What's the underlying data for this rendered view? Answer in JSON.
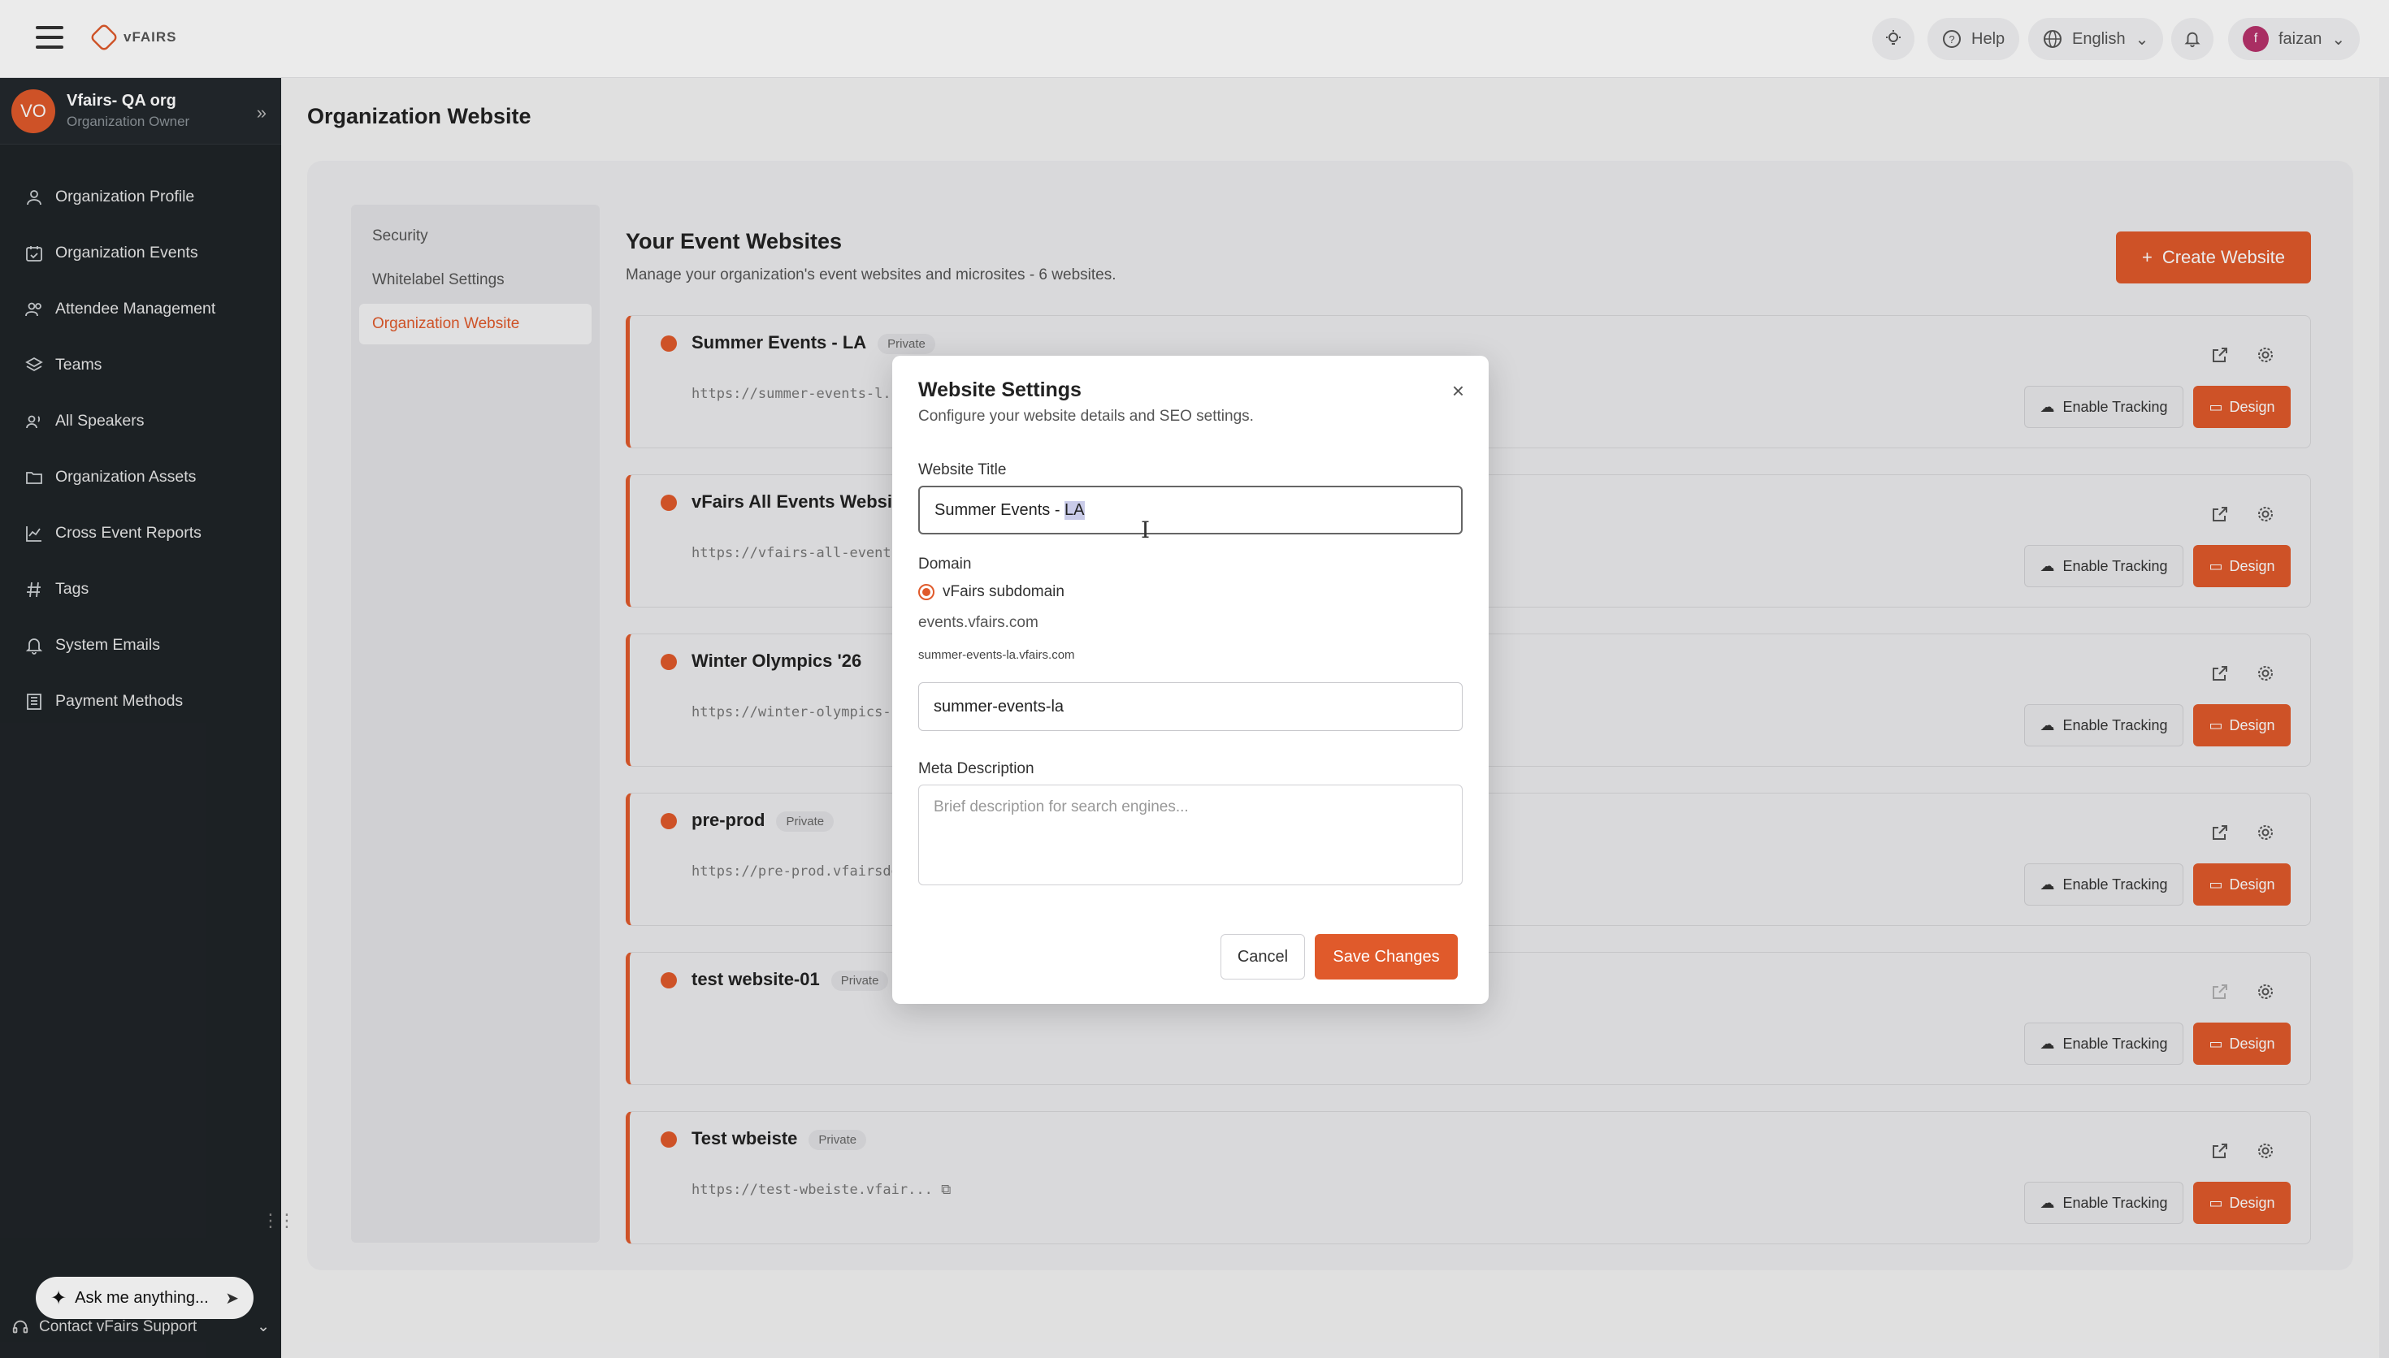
{
  "topbar": {
    "logo_text": "vFAIRS",
    "help_label": "Help",
    "language": "English",
    "user_initial": "f",
    "user_name": "faizan"
  },
  "sidebar": {
    "org_initials": "VO",
    "org_name": "Vfairs- QA org",
    "org_role": "Organization Owner",
    "items": [
      {
        "label": "Organization Profile",
        "icon": "user-icon"
      },
      {
        "label": "Organization Events",
        "icon": "calendar-check-icon"
      },
      {
        "label": "Attendee Management",
        "icon": "users-icon"
      },
      {
        "label": "Teams",
        "icon": "layers-icon"
      },
      {
        "label": "All Speakers",
        "icon": "speakers-icon"
      },
      {
        "label": "Organization Assets",
        "icon": "folder-icon"
      },
      {
        "label": "Cross Event Reports",
        "icon": "line-chart-icon"
      },
      {
        "label": "Tags",
        "icon": "hash-icon"
      },
      {
        "label": "System Emails",
        "icon": "bell-icon"
      },
      {
        "label": "Payment Methods",
        "icon": "building-icon"
      }
    ],
    "ask_placeholder": "Ask me anything...",
    "support_label": "Contact vFairs Support"
  },
  "page": {
    "title": "Organization Website"
  },
  "subnav": {
    "items": [
      "Security",
      "Whitelabel Settings",
      "Organization Website"
    ],
    "active": "Organization Website"
  },
  "websites": {
    "title": "Your Event Websites",
    "subtitle": "Manage your organization's event websites and microsites - 6 websites.",
    "create_label": "Create Website",
    "track_label": "Enable Tracking",
    "design_label": "Design",
    "items": [
      {
        "name": "Summer Events - LA",
        "badge": "Private",
        "url": "https://summer-events-l..."
      },
      {
        "name": "vFairs All Events Website",
        "badge": "",
        "url": "https://vfairs-all-events-..."
      },
      {
        "name": "Winter Olympics '26",
        "badge": "",
        "url": "https://winter-olympics-..."
      },
      {
        "name": "pre-prod",
        "badge": "Private",
        "url": "https://pre-prod.vfairsde..."
      },
      {
        "name": "test website-01",
        "badge": "Private",
        "url": ""
      },
      {
        "name": "Test wbeiste",
        "badge": "Private",
        "url": "https://test-wbeiste.vfair..."
      }
    ]
  },
  "modal": {
    "title": "Website Settings",
    "subtitle": "Configure your website details and SEO settings.",
    "website_title_label": "Website Title",
    "website_title_value_plain": "Summer Events - ",
    "website_title_value_selected": "LA",
    "domain_label": "Domain",
    "domain_option": "vFairs subdomain",
    "domain_base": "events.vfairs.com",
    "domain_preview": "summer-events-la.vfairs.com",
    "subdomain_value": "summer-events-la",
    "meta_label": "Meta Description",
    "meta_placeholder": "Brief description for search engines...",
    "cancel_label": "Cancel",
    "save_label": "Save Changes"
  },
  "colors": {
    "accent": "#e05a2b",
    "sidebar_bg": "#1f2428"
  }
}
